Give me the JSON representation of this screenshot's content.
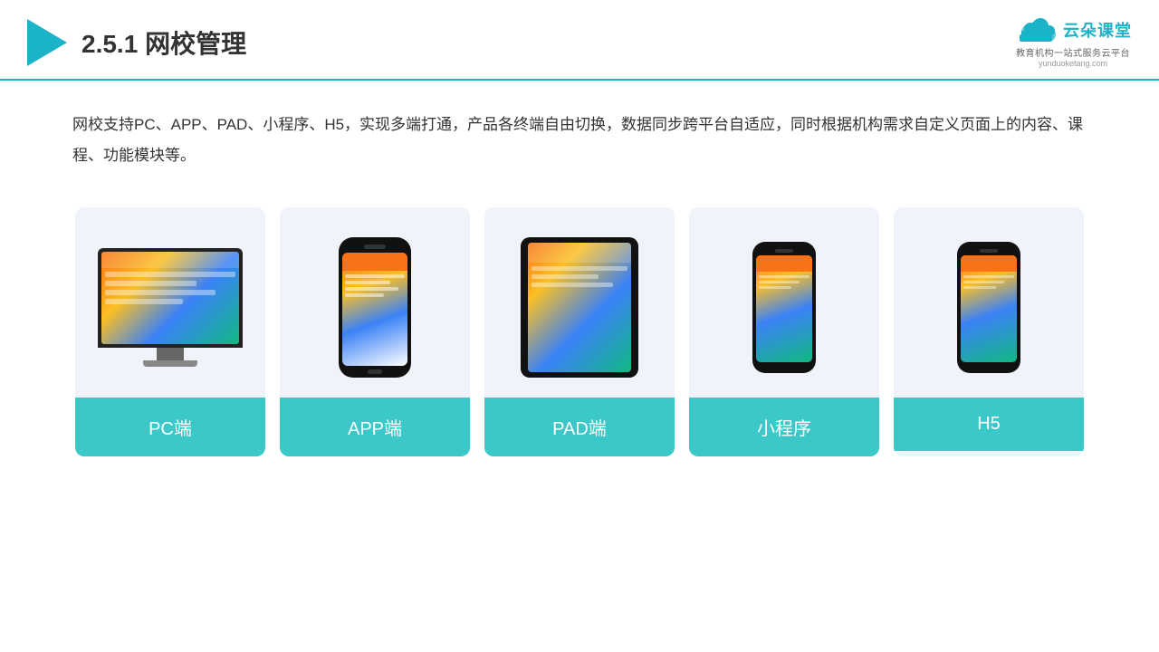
{
  "header": {
    "title_number": "2.5.1",
    "title_text": "网校管理",
    "logo_text": "云朵课堂",
    "logo_domain": "yunduoketang.com",
    "logo_tagline": "教育机构一站式服务云平台"
  },
  "description": {
    "text": "网校支持PC、APP、PAD、小程序、H5，实现多端打通，产品各终端自由切换，数据同步跨平台自适应，同时根据机构需求自定义页面上的内容、课程、功能模块等。"
  },
  "cards": [
    {
      "label": "PC端",
      "type": "pc"
    },
    {
      "label": "APP端",
      "type": "phone"
    },
    {
      "label": "PAD端",
      "type": "tablet"
    },
    {
      "label": "小程序",
      "type": "phone-mini"
    },
    {
      "label": "H5",
      "type": "phone-mini"
    }
  ],
  "accent_color": "#3cc8c8"
}
